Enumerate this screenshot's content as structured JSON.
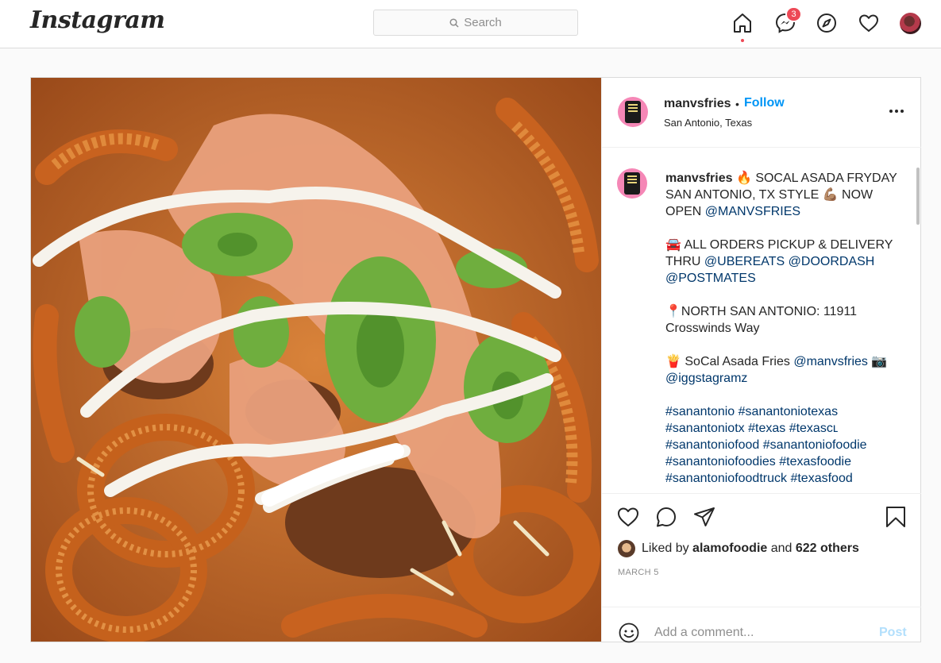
{
  "nav": {
    "logo": "Instagram",
    "search_placeholder": "Search",
    "messages_badge": "3"
  },
  "post": {
    "username": "manvsfries",
    "follow_separator": "•",
    "follow_label": "Follow",
    "location": "San Antonio, Texas",
    "caption": [
      {
        "runs": [
          {
            "text": "manvsfries",
            "type": "user"
          },
          {
            "text": " 🔥 SOCAL ASADA FRYDAY SAN ANTONIO, TX STYLE 💪🏽 NOW OPEN ",
            "type": "text"
          },
          {
            "text": "@MANVSFRIES",
            "type": "link"
          }
        ]
      },
      {
        "runs": [
          {
            "text": "🚘 ALL ORDERS PICKUP & DELIVERY THRU ",
            "type": "text"
          },
          {
            "text": "@UBEREATS",
            "type": "link"
          },
          {
            "text": " ",
            "type": "text"
          },
          {
            "text": "@DOORDASH",
            "type": "link"
          },
          {
            "text": " ",
            "type": "text"
          },
          {
            "text": "@POSTMATES",
            "type": "link"
          }
        ]
      },
      {
        "runs": [
          {
            "text": "📍NORTH SAN ANTONIO: 11911 Crosswinds Way",
            "type": "text"
          }
        ]
      },
      {
        "runs": [
          {
            "text": "🍟 SoCal Asada Fries ",
            "type": "text"
          },
          {
            "text": "@manvsfries",
            "type": "link"
          },
          {
            "text": " 📷 ",
            "type": "text"
          },
          {
            "text": "@iggstagramz",
            "type": "link"
          }
        ]
      },
      {
        "runs": [
          {
            "text": "#sanantonio",
            "type": "link"
          },
          {
            "text": " ",
            "type": "text"
          },
          {
            "text": "#sanantoniotexas",
            "type": "link"
          },
          {
            "text": " ",
            "type": "text"
          },
          {
            "text": "#sanantoniotx",
            "type": "link"
          },
          {
            "text": " ",
            "type": "text"
          },
          {
            "text": "#texas",
            "type": "link"
          },
          {
            "text": " ",
            "type": "text"
          },
          {
            "text": "#texasᴄʟ",
            "type": "link"
          },
          {
            "text": " ",
            "type": "text"
          },
          {
            "text": "#sanantoniofood",
            "type": "link"
          },
          {
            "text": " ",
            "type": "text"
          },
          {
            "text": "#sanantoniofoodie",
            "type": "link"
          },
          {
            "text": " ",
            "type": "text"
          },
          {
            "text": "#sanantoniofoodies",
            "type": "link"
          },
          {
            "text": " ",
            "type": "text"
          },
          {
            "text": "#texasfoodie",
            "type": "link"
          },
          {
            "text": " ",
            "type": "text"
          },
          {
            "text": "#sanantoniofoodtruck",
            "type": "link"
          },
          {
            "text": " ",
            "type": "text"
          },
          {
            "text": "#texasfood",
            "type": "link"
          }
        ]
      }
    ],
    "likes_prefix": "Liked by ",
    "likes_user": "alamofoodie",
    "likes_suffix": " and ",
    "likes_others": "622 others",
    "date": "MARCH 5",
    "comment_placeholder": "Add a comment...",
    "post_button": "Post"
  },
  "icons": {
    "search": "search-icon",
    "home": "home-icon",
    "messenger": "messenger-icon",
    "explore": "compass-icon",
    "activity": "heart-icon",
    "like": "heart-outline-icon",
    "comment": "comment-icon",
    "share": "paper-plane-icon",
    "save": "bookmark-icon",
    "emoji": "smiley-icon",
    "more": "more-options-icon"
  },
  "colors": {
    "follow_blue": "#0095f6",
    "link_blue": "#00376b",
    "badge_red": "#ed4956",
    "post_disabled": "#b2dffc",
    "avatar_ring_pink": "#f587b6"
  }
}
